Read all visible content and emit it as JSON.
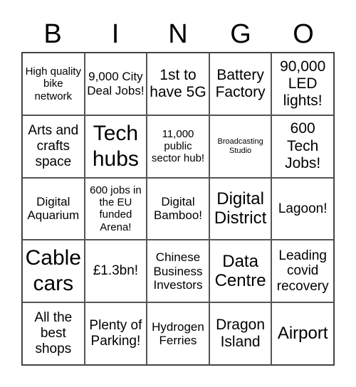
{
  "header": {
    "letters": [
      "B",
      "I",
      "N",
      "G",
      "O"
    ]
  },
  "cells": [
    "High quality bike network",
    "9,000 City Deal Jobs!",
    "1st to have 5G",
    "Battery Factory",
    "90,000 LED lights!",
    "Arts and crafts space",
    "Tech hubs",
    "11,000 public sector hub!",
    "Broadcasting Studio",
    "600 Tech Jobs!",
    "Digital Aquarium",
    "600 jobs in the EU funded Arena!",
    "Digital Bamboo!",
    "Digital District",
    "Lagoon!",
    "Cable cars",
    "£1.3bn!",
    "Chinese Business Investors",
    "Data Centre",
    "Leading covid recovery",
    "All the best shops",
    "Plenty of Parking!",
    "Hydrogen Ferries",
    "Dragon Island",
    "Airport"
  ]
}
